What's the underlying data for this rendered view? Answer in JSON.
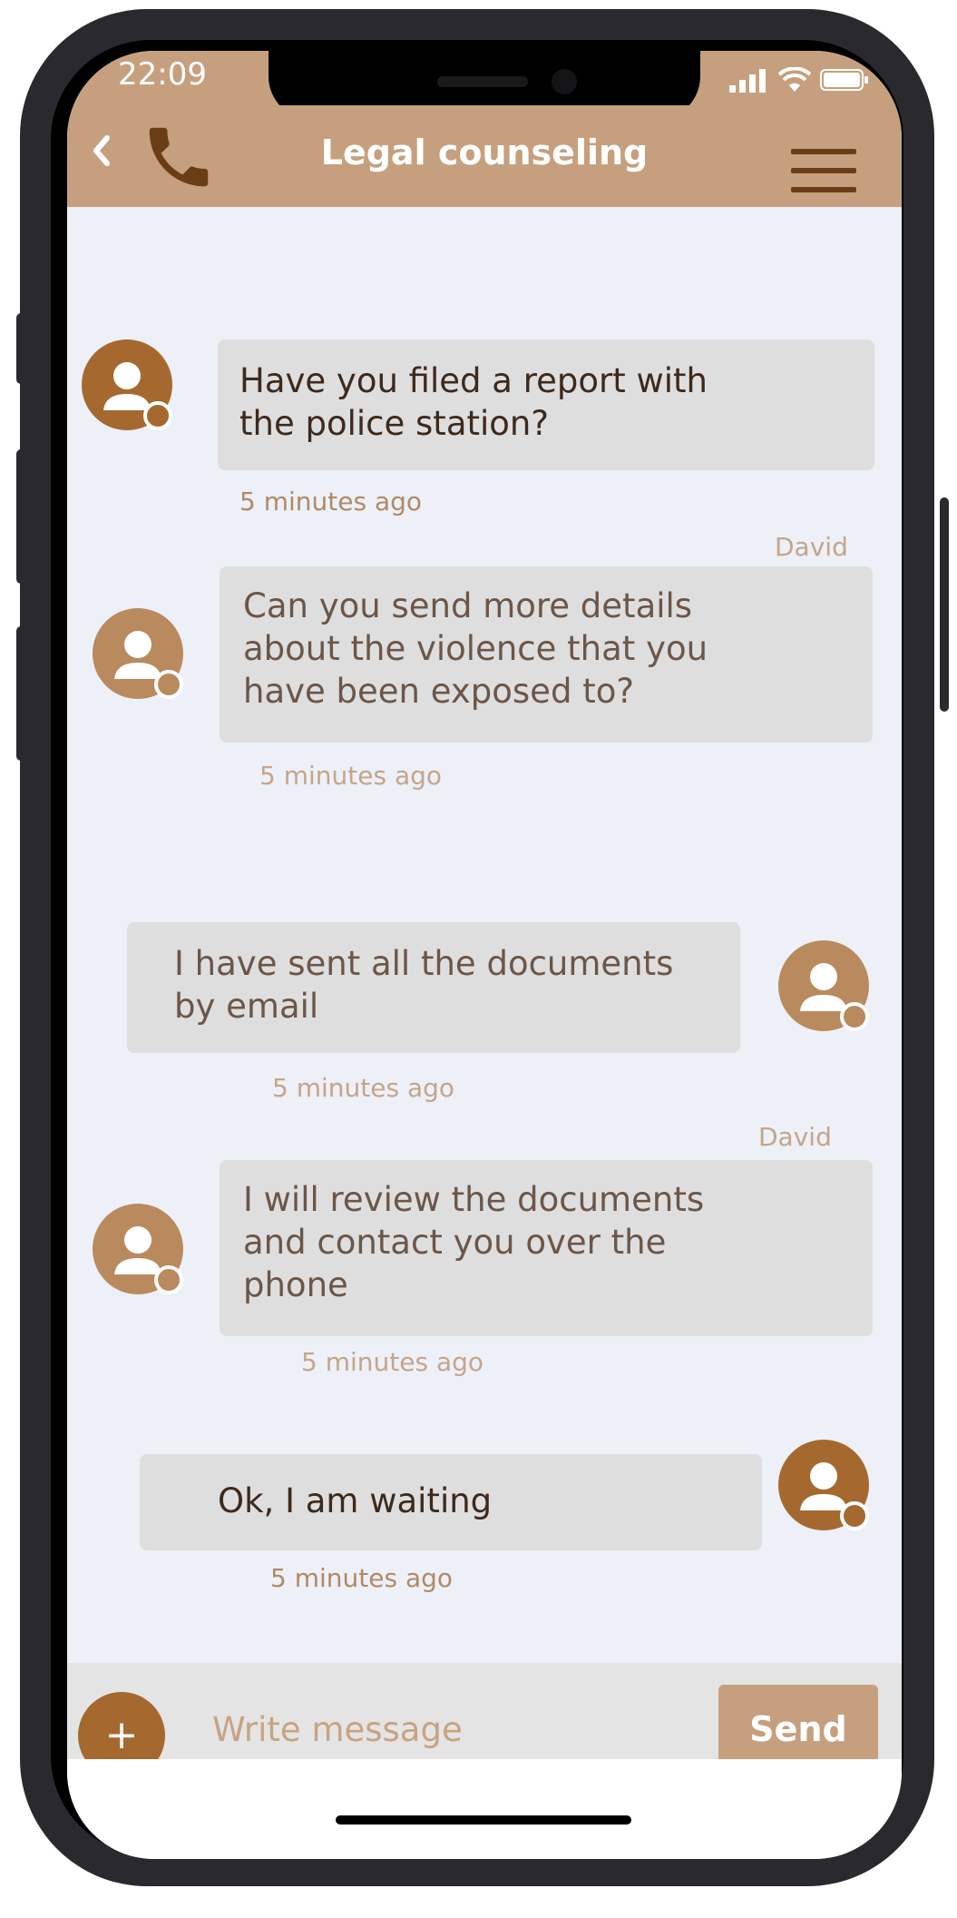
{
  "status_bar": {
    "time": "22:09"
  },
  "header": {
    "title": "Legal counseling",
    "back_icon": "chevron-left-icon",
    "call_icon": "phone-icon",
    "menu_icon": "hamburger-menu-icon"
  },
  "colors": {
    "header_bg": "#c6a07e",
    "chat_bg": "#edf0f7",
    "bubble_bg": "#dedede",
    "accent": "#a5692f",
    "timestamp": "#b08a65"
  },
  "messages": [
    {
      "side": "left",
      "sender": "",
      "lines": [
        "Have you filed a report with",
        "the police station?"
      ],
      "time": "5 minutes ago"
    },
    {
      "side": "left",
      "sender": "David",
      "lines": [
        "Can you send more details",
        "about the violence that you",
        "have been exposed to?"
      ],
      "time": "5 minutes ago"
    },
    {
      "side": "right",
      "sender": "",
      "lines": [
        "I have sent all the documents",
        "by email"
      ],
      "time": "5 minutes ago"
    },
    {
      "side": "left",
      "sender": "David",
      "lines": [
        "I will review the documents",
        "and contact you over the",
        "phone"
      ],
      "time": "5 minutes ago"
    },
    {
      "side": "right",
      "sender": "",
      "lines": [
        "Ok, I am waiting"
      ],
      "time": "5 minutes ago"
    }
  ],
  "composer": {
    "add_label": "+",
    "placeholder": "Write message",
    "send_label": "Send"
  }
}
